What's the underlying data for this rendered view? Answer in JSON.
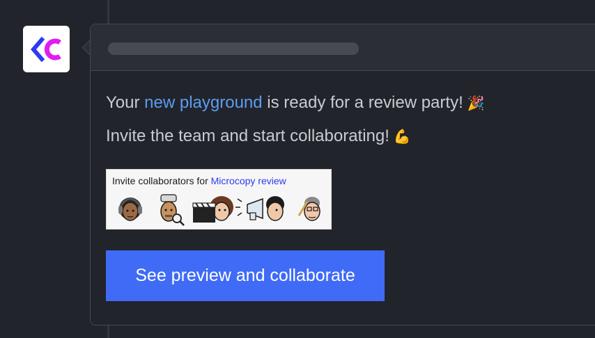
{
  "message": {
    "line1_before": "Your ",
    "line1_link": "new playground",
    "line1_after": " is ready for a review party!",
    "line1_emoji": "🎉",
    "line2": "Invite the team and start collaborating!",
    "line2_emoji": "💪"
  },
  "invite_banner": {
    "prefix": "Invite collaborators for ",
    "project_name": "Microcopy review"
  },
  "cta": {
    "label": "See preview and collaborate"
  },
  "colors": {
    "background": "#22242b",
    "accent_button": "#3f6bf7",
    "link": "#5b9df2",
    "logo_blue": "#2d3bf0",
    "logo_magenta": "#e21cf0"
  },
  "icons": {
    "logo": "codesandbox-style-logo-icon",
    "avatars": [
      "headphones-avatar-icon",
      "magnifier-avatar-icon",
      "clapperboard-avatar-icon",
      "megaphone-avatar-icon",
      "pencil-avatar-icon"
    ]
  }
}
